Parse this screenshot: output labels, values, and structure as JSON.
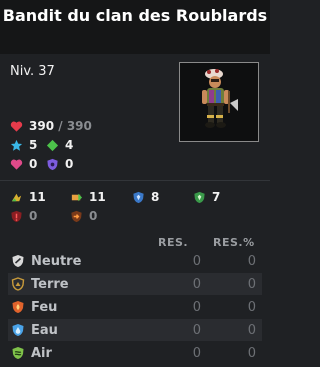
{
  "title": "Bandit du clan des Roublards",
  "level": "Niv. 37",
  "stats": {
    "hp": {
      "current": "390",
      "separator": " / ",
      "max": "390"
    },
    "ap": "5",
    "mp": "4",
    "shield": "0",
    "other": "0"
  },
  "combat": {
    "dodge_ap": "11",
    "dodge_mp": "11",
    "block": "8",
    "lock": "7",
    "crit_resist": "0",
    "pushback_resist": "0"
  },
  "resistances": {
    "header_res": "RES.",
    "header_res_pct": "RES.%",
    "rows": [
      {
        "name": "Neutre",
        "res": "0",
        "res_pct": "0",
        "color": "#cfcfcf"
      },
      {
        "name": "Terre",
        "res": "0",
        "res_pct": "0",
        "color": "#c79a3b"
      },
      {
        "name": "Feu",
        "res": "0",
        "res_pct": "0",
        "color": "#e0632c"
      },
      {
        "name": "Eau",
        "res": "0",
        "res_pct": "0",
        "color": "#4aa3e8"
      },
      {
        "name": "Air",
        "res": "0",
        "res_pct": "0",
        "color": "#7fc24a"
      }
    ]
  },
  "colors": {
    "background": "#1f2124",
    "title_bar": "#151617",
    "heart": "#e63b4b",
    "star": "#3ab8e8",
    "diamond": "#4cc24a",
    "pink_heart": "#e04a8a",
    "purple_shield": "#7d5ce0"
  }
}
